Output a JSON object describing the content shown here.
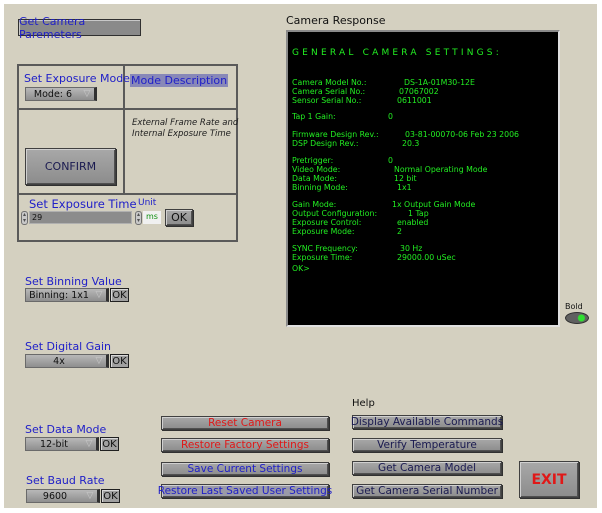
{
  "app": {
    "get_params_button": "Get Camera Paremeters"
  },
  "exposure_mode": {
    "label": "Set Exposure Mode",
    "selected": "Mode: 6",
    "description_header": "Mode Description",
    "description_text_line1": "External Frame Rate and",
    "description_text_line2": "Internal Exposure Time",
    "confirm_button": "CONFIRM"
  },
  "exposure_time": {
    "label": "Set Exposure Time",
    "value": "29",
    "unit_label": "Unit",
    "unit_value": "ms",
    "ok_button": "OK"
  },
  "binning": {
    "label": "Set Binning Value",
    "selected": "Binning: 1x1",
    "ok_button": "OK"
  },
  "digital_gain": {
    "label": "Set Digital Gain",
    "selected": "4x",
    "ok_button": "OK"
  },
  "data_mode": {
    "label": "Set Data Mode",
    "selected": "12-bit",
    "ok_button": "OK"
  },
  "baud_rate": {
    "label": "Set Baud Rate",
    "selected": "9600",
    "ok_button": "OK"
  },
  "camera_response": {
    "title": "Camera Response",
    "heading": "GENERAL CAMERA SETTINGS:",
    "rows": [
      {
        "key": "Camera Model No.:",
        "value": "DS-1A-01M30-12E"
      },
      {
        "key": "Camera Serial No.:",
        "value": "07067002"
      },
      {
        "key": "Sensor Serial No.:",
        "value": "0611001"
      },
      {
        "key": "Tap 1 Gain:",
        "value": "0"
      },
      {
        "key": "Firmware Design Rev.:",
        "value": "03-81-00070-06  Feb 23 2006"
      },
      {
        "key": "DSP Design Rev.:",
        "value": "20.3"
      },
      {
        "key": "Pretrigger:",
        "value": "0"
      },
      {
        "key": "Video Mode:",
        "value": "Normal Operating Mode"
      },
      {
        "key": "Data Mode:",
        "value": "12 bit"
      },
      {
        "key": "Binning Mode:",
        "value": "1x1"
      },
      {
        "key": "Gain Mode:",
        "value": "1x Output Gain Mode"
      },
      {
        "key": "Output Configuration:",
        "value": "1 Tap"
      },
      {
        "key": "Exposure Control:",
        "value": "enabled"
      },
      {
        "key": "Exposure Mode:",
        "value": "2"
      },
      {
        "key": "SYNC Frequency:",
        "value": "30 Hz"
      },
      {
        "key": "Exposure Time:",
        "value": "29000.00 uSec"
      }
    ],
    "prompt": "OK>",
    "bold_toggle_label": "Bold",
    "bold_toggle_on": true
  },
  "actions": {
    "reset_camera": "Reset Camera",
    "restore_factory": "Restore Factory Settings",
    "save_current": "Save Current Settings",
    "restore_last_saved": "Restore Last Saved User Settings"
  },
  "help": {
    "label": "Help",
    "display_commands": "Display Available Commands",
    "verify_temperature": "Verify Temperature",
    "get_model": "Get Camera Model",
    "get_serial": "Get Camera Serial Number"
  },
  "exit_button": "EXIT",
  "colors": {
    "background": "#d4d0c0",
    "label_blue": "#2020c8",
    "warning_red": "#e01818",
    "terminal_green": "#22ee22",
    "terminal_bg": "#000000"
  }
}
